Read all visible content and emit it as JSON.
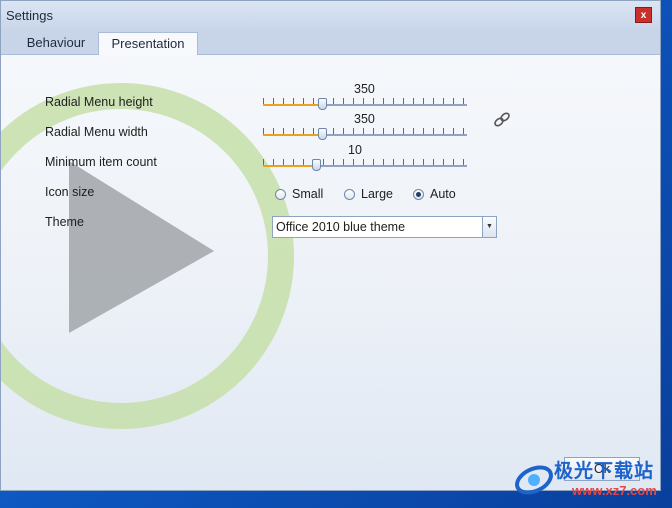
{
  "window": {
    "title": "Settings",
    "close_label": "x"
  },
  "tabs": [
    {
      "label": "Behaviour",
      "active": false
    },
    {
      "label": "Presentation",
      "active": true
    }
  ],
  "settings": {
    "radial_height": {
      "label": "Radial Menu height",
      "value": "350",
      "fraction": 0.29
    },
    "radial_width": {
      "label": "Radial Menu width",
      "value": "350",
      "fraction": 0.29
    },
    "min_items": {
      "label": "Minimum item count",
      "value": "10",
      "fraction": 0.26
    },
    "icon_size": {
      "label": "Icon size",
      "options": [
        "Small",
        "Large",
        "Auto"
      ],
      "selected": "Auto"
    },
    "theme": {
      "label": "Theme",
      "value": "Office 2010 blue theme"
    }
  },
  "buttons": {
    "ok": "Ok"
  },
  "watermark": {
    "brand": "极光下载站",
    "url": "www.xz7.com"
  },
  "colors": {
    "accent_fill": "#e9a21f",
    "close_red": "#c7302b",
    "tab_strip": "#c8d5e9"
  }
}
